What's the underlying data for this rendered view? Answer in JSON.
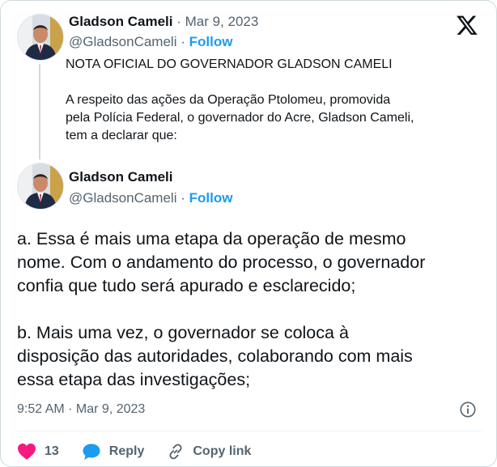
{
  "parent_tweet": {
    "author_name": "Gladson Cameli",
    "date": "Mar 9, 2023",
    "handle": "@GladsonCameli",
    "follow_label": "Follow",
    "title": "NOTA OFICIAL DO GOVERNADOR GLADSON CAMELI",
    "body_lines": [
      "A respeito das ações da Operação Ptolomeu, promovida",
      "pela Polícia Federal, o governador do Acre, Gladson Cameli,",
      "tem a declarar que:"
    ]
  },
  "main_tweet": {
    "author_name": "Gladson Cameli",
    "handle": "@GladsonCameli",
    "follow_label": "Follow",
    "paragraph_a_lines": [
      "a. Essa é mais uma etapa da operação de mesmo",
      "nome. Com o andamento do processo, o governador",
      "confia que tudo será apurado e esclarecido;"
    ],
    "paragraph_b_lines": [
      "b. Mais uma vez, o governador se coloca à",
      "disposição das autoridades, colaborando com mais",
      "essa etapa das investigações;"
    ],
    "timestamp": "9:52 AM · Mar 9, 2023"
  },
  "actions": {
    "like_count": "13",
    "reply_label": "Reply",
    "copy_link_label": "Copy link"
  },
  "icons": {
    "logo": "x-logo-icon",
    "like": "heart-icon",
    "reply": "speech-bubble-icon",
    "copy": "link-icon",
    "info": "info-icon"
  },
  "colors": {
    "accent": "#1d9bf0",
    "like": "#f91880",
    "muted": "#536471",
    "text": "#0f1419"
  }
}
